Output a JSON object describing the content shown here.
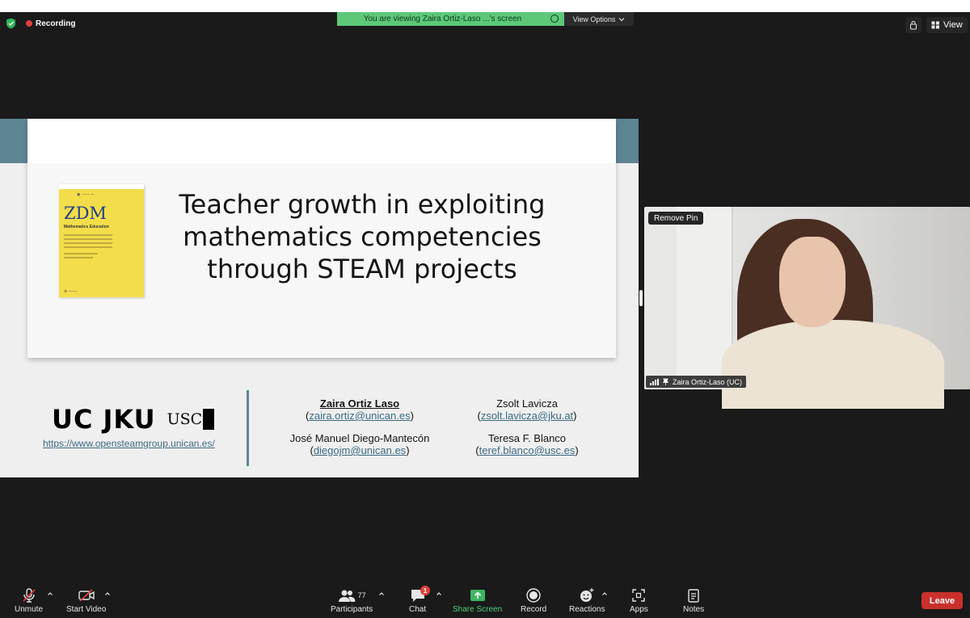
{
  "status": {
    "recording_label": "Recording",
    "share_banner": "You are viewing Zaira Ortiz-Laso ...'s screen",
    "view_options_label": "View Options",
    "view_label": "View"
  },
  "slide": {
    "title_line1": "Teacher growth in exploiting",
    "title_line2": "mathematics competencies",
    "title_line3": "through STEAM projects",
    "book": {
      "title": "ZDM",
      "subtitle": "Mathematics Education"
    },
    "logos": {
      "uc": "UC",
      "jku": "JKU",
      "usc": "USC"
    },
    "website": "https://www.opensteamgroup.unican.es/",
    "authors": [
      {
        "name": "Zaira Ortiz Laso",
        "email": "zaira.ortiz@unican.es"
      },
      {
        "name": "Zsolt Lavicza",
        "email": "zsolt.lavicza@jku.at"
      },
      {
        "name": "José Manuel Diego-Mantecón",
        "email": "diegojm@unican.es"
      },
      {
        "name": "Teresa F. Blanco",
        "email": "teref.blanco@usc.es"
      }
    ]
  },
  "video_tile": {
    "remove_pin_label": "Remove Pin",
    "participant_name": "Zaira Ortiz-Laso (UC)"
  },
  "toolbar": {
    "unmute": "Unmute",
    "start_video": "Start Video",
    "participants": "Participants",
    "participants_count": "77",
    "chat": "Chat",
    "chat_badge": "1",
    "share_screen": "Share Screen",
    "record": "Record",
    "reactions": "Reactions",
    "apps": "Apps",
    "notes": "Notes",
    "leave": "Leave"
  },
  "colors": {
    "share_green": "#5cc878",
    "slide_teal": "#5e8594",
    "leave_red": "#c9302c",
    "record_red": "#e0403c"
  }
}
